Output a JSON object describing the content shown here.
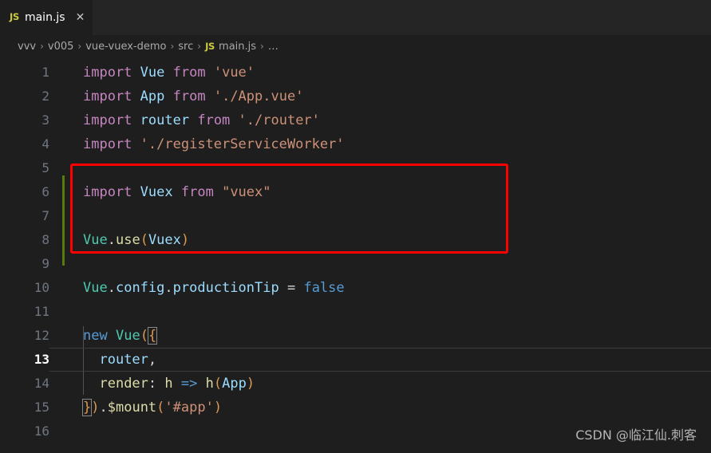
{
  "window": {
    "background": "#1e1e1e",
    "tabbar_background": "#252526"
  },
  "tab": {
    "icon": "js-file-icon",
    "icon_label": "JS",
    "label": "main.js",
    "close_label": "✕"
  },
  "breadcrumb": {
    "separator": "›",
    "items": [
      {
        "label": "vvv"
      },
      {
        "label": "v005"
      },
      {
        "label": "vue-vuex-demo"
      },
      {
        "label": "src"
      },
      {
        "label": "main.js",
        "icon_label": "JS"
      },
      {
        "label": "…"
      }
    ]
  },
  "editor": {
    "active_line": 13,
    "lines": [
      {
        "n": "1",
        "text": "import Vue from 'vue'"
      },
      {
        "n": "2",
        "text": "import App from './App.vue'"
      },
      {
        "n": "3",
        "text": "import router from './router'"
      },
      {
        "n": "4",
        "text": "import './registerServiceWorker'"
      },
      {
        "n": "5",
        "text": ""
      },
      {
        "n": "6",
        "text": "import Vuex from \"vuex\""
      },
      {
        "n": "7",
        "text": ""
      },
      {
        "n": "8",
        "text": "Vue.use(Vuex)"
      },
      {
        "n": "9",
        "text": ""
      },
      {
        "n": "10",
        "text": "Vue.config.productionTip = false"
      },
      {
        "n": "11",
        "text": ""
      },
      {
        "n": "12",
        "text": "new Vue({"
      },
      {
        "n": "13",
        "text": "  router,"
      },
      {
        "n": "14",
        "text": "  render: h => h(App)"
      },
      {
        "n": "15",
        "text": "}).$mount('#app')"
      },
      {
        "n": "16",
        "text": ""
      }
    ],
    "git_change_indicator": {
      "color": "#587c0c",
      "from_line": 6,
      "to_line": 9
    }
  },
  "annotation": {
    "type": "rectangle",
    "color": "#ff0000",
    "covers_lines": "6-9"
  },
  "watermark": {
    "text": "CSDN @临江仙.刺客"
  },
  "theme_colors": {
    "keyword": "#c586c0",
    "identifier": "#9cdcfe",
    "string": "#ce9178",
    "class": "#4ec9b0",
    "function": "#dcdcaa",
    "paren": "#da9a53",
    "blue_keyword": "#569cd6",
    "plain": "#d4d4d4",
    "line_number": "#6e7681",
    "active_line_number": "#ffffff"
  }
}
